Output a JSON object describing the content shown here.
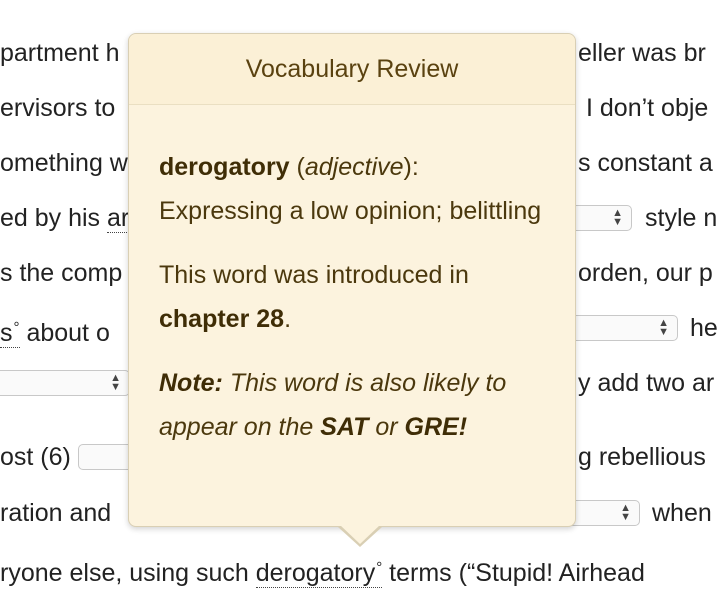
{
  "background_text": {
    "lines_left": [
      "partment h",
      "ervisors to",
      "omething w",
      "ed by his ",
      "s the comp",
      "s",
      "",
      "ost (6)",
      "ration and"
    ],
    "line4_dotted": "ar",
    "line6_dotted_tail": " about o",
    "lines_right": [
      "eller was br",
      "I don’t obje",
      "s constant a",
      "style n",
      "orden, our p",
      "he",
      "y add two ar",
      "g rebellious",
      "when"
    ],
    "bottom_line_prefix": "ryone else, using such ",
    "bottom_line_word": "derogatory",
    "bottom_line_suffix": " terms (“Stupid! Airhead"
  },
  "popover": {
    "title": "Vocabulary Review",
    "word": "derogatory",
    "part_of_speech": "adjective",
    "definition": "Expressing a low opinion; belittling",
    "intro_text": "This word was introduced in",
    "chapter": "chapter 28",
    "note_label": "Note:",
    "note_text": " This word is also likely to appear on the ",
    "exam1": "SAT",
    "or_text": " or ",
    "exam2": "GRE!"
  },
  "glyphs": {
    "degree": "°",
    "select_arrows_up": "▲",
    "select_arrows_down": "▼"
  }
}
